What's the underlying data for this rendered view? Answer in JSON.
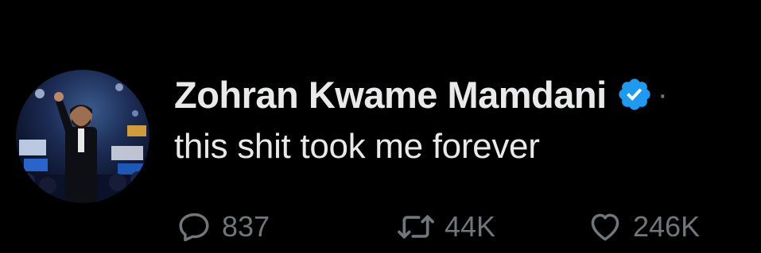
{
  "tweet": {
    "author": {
      "display_name": "Zohran Kwame Mamdani",
      "verified": true,
      "verified_badge_icon": "verified-badge-icon",
      "avatar": "profile-photo"
    },
    "separator": "·",
    "text": "this shit took me forever",
    "actions": {
      "reply": {
        "icon": "reply-icon",
        "count": "837"
      },
      "retweet": {
        "icon": "retweet-icon",
        "count": "44K"
      },
      "like": {
        "icon": "heart-icon",
        "count": "246K"
      }
    }
  },
  "colors": {
    "background": "#000000",
    "primary_text": "#e7e9ea",
    "secondary_text": "#71767b",
    "verified_blue": "#1d9bf0"
  }
}
